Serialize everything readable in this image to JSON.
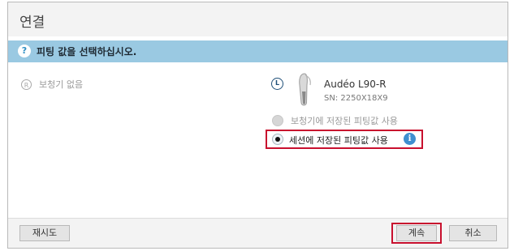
{
  "dialog": {
    "title": "연결",
    "prompt_icon": "?",
    "prompt": "피팅 값을 선택하십시오."
  },
  "left_side": {
    "badge": "R",
    "label": "보청기 없음"
  },
  "right_side": {
    "badge": "L",
    "device_name": "Audéo L90-R",
    "serial": "SN: 2250X18X9",
    "device_icon": "hearing-aid-icon"
  },
  "options": [
    {
      "label": "보청기에 저장된 피팅값 사용",
      "selected": false,
      "enabled": false
    },
    {
      "label": "세션에 저장된 피팅값 사용",
      "selected": true,
      "enabled": true,
      "info_icon": "i"
    }
  ],
  "footer": {
    "retry_label": "재시도",
    "continue_label": "계속",
    "cancel_label": "취소"
  },
  "colors": {
    "prompt_bar": "#9ac9e2",
    "highlight": "#c8102e",
    "info": "#3f8fd0"
  }
}
